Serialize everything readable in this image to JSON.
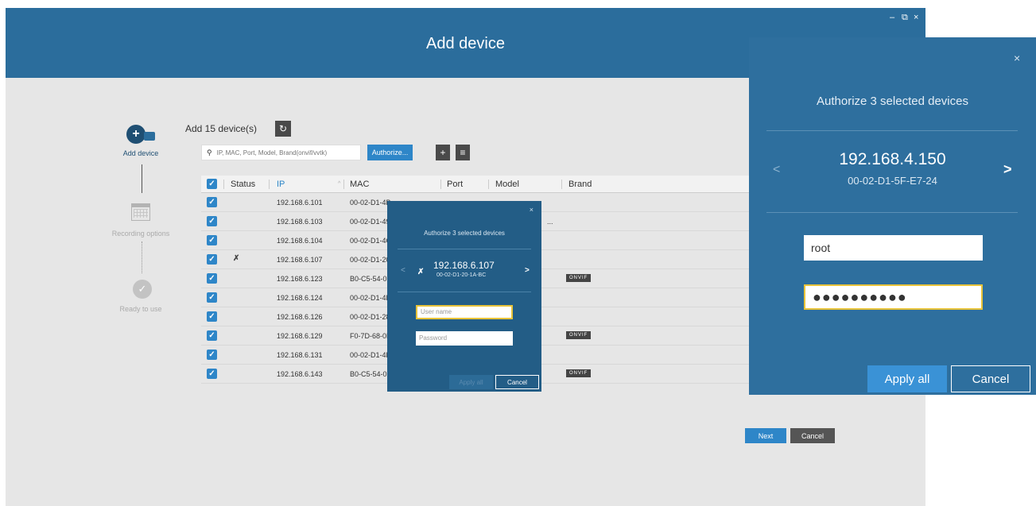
{
  "window": {
    "title": "Add device",
    "controls": [
      "–",
      "⧉",
      "×"
    ]
  },
  "steps": [
    {
      "label": "Add device",
      "state": "active"
    },
    {
      "label": "Recording options",
      "state": "inactive"
    },
    {
      "label": "Ready to use",
      "state": "inactive"
    }
  ],
  "toolbar": {
    "add_count_label": "Add 15 device(s)",
    "search_placeholder": "IP, MAC, Port, Model, Brand(onvif/vvtk)",
    "authorize_label": "Authorize...",
    "add_icon": "+",
    "list_icon": "≡"
  },
  "table": {
    "columns": [
      "Status",
      "IP",
      "MAC",
      "Port",
      "Model",
      "Brand"
    ],
    "rows": [
      {
        "ip": "192.168.6.101",
        "mac": "00-02-D1-4B",
        "onvif": "",
        "status_icon": ""
      },
      {
        "ip": "192.168.6.103",
        "mac": "00-02-D1-49",
        "onvif": "",
        "status_icon": ""
      },
      {
        "ip": "192.168.6.104",
        "mac": "00-02-D1-4C",
        "onvif": "",
        "status_icon": ""
      },
      {
        "ip": "192.168.6.107",
        "mac": "00-02-D1-20",
        "onvif": "",
        "status_icon": "unauthorized"
      },
      {
        "ip": "192.168.6.123",
        "mac": "B0-C5-54-06",
        "onvif": "ONVIF",
        "status_icon": ""
      },
      {
        "ip": "192.168.6.124",
        "mac": "00-02-D1-4B",
        "onvif": "",
        "status_icon": ""
      },
      {
        "ip": "192.168.6.126",
        "mac": "00-02-D1-28",
        "onvif": "",
        "status_icon": ""
      },
      {
        "ip": "192.168.6.129",
        "mac": "F0-7D-68-0F",
        "onvif": "ONVIF",
        "status_icon": ""
      },
      {
        "ip": "192.168.6.131",
        "mac": "00-02-D1-4B",
        "onvif": "",
        "status_icon": ""
      },
      {
        "ip": "192.168.6.143",
        "mac": "B0-C5-54-06",
        "onvif": "ONVIF",
        "status_icon": ""
      }
    ],
    "row2_truncation": "..."
  },
  "footer": {
    "next_label": "Next",
    "cancel_label": "Cancel"
  },
  "small_dialog": {
    "title": "Authorize 3 selected devices",
    "ip": "192.168.6.107",
    "mac": "00-02-D1-20-1A-BC",
    "username_placeholder": "User name",
    "password_placeholder": "Password",
    "apply_label": "Apply all",
    "cancel_label": "Cancel",
    "close": "×",
    "prev": "<",
    "next": ">"
  },
  "big_dialog": {
    "title": "Authorize 3 selected devices",
    "ip": "192.168.4.150",
    "mac": "00-02-D1-5F-E7-24",
    "username_value": "root",
    "password_value": "●●●●●●●●●●",
    "apply_label": "Apply all",
    "cancel_label": "Cancel",
    "close": "×",
    "prev": "<",
    "next": ">"
  },
  "colors": {
    "header": "#2b6d9c",
    "accent": "#2e86c8",
    "dialog_small": "#235d86",
    "dialog_big": "#2e6f9e"
  }
}
